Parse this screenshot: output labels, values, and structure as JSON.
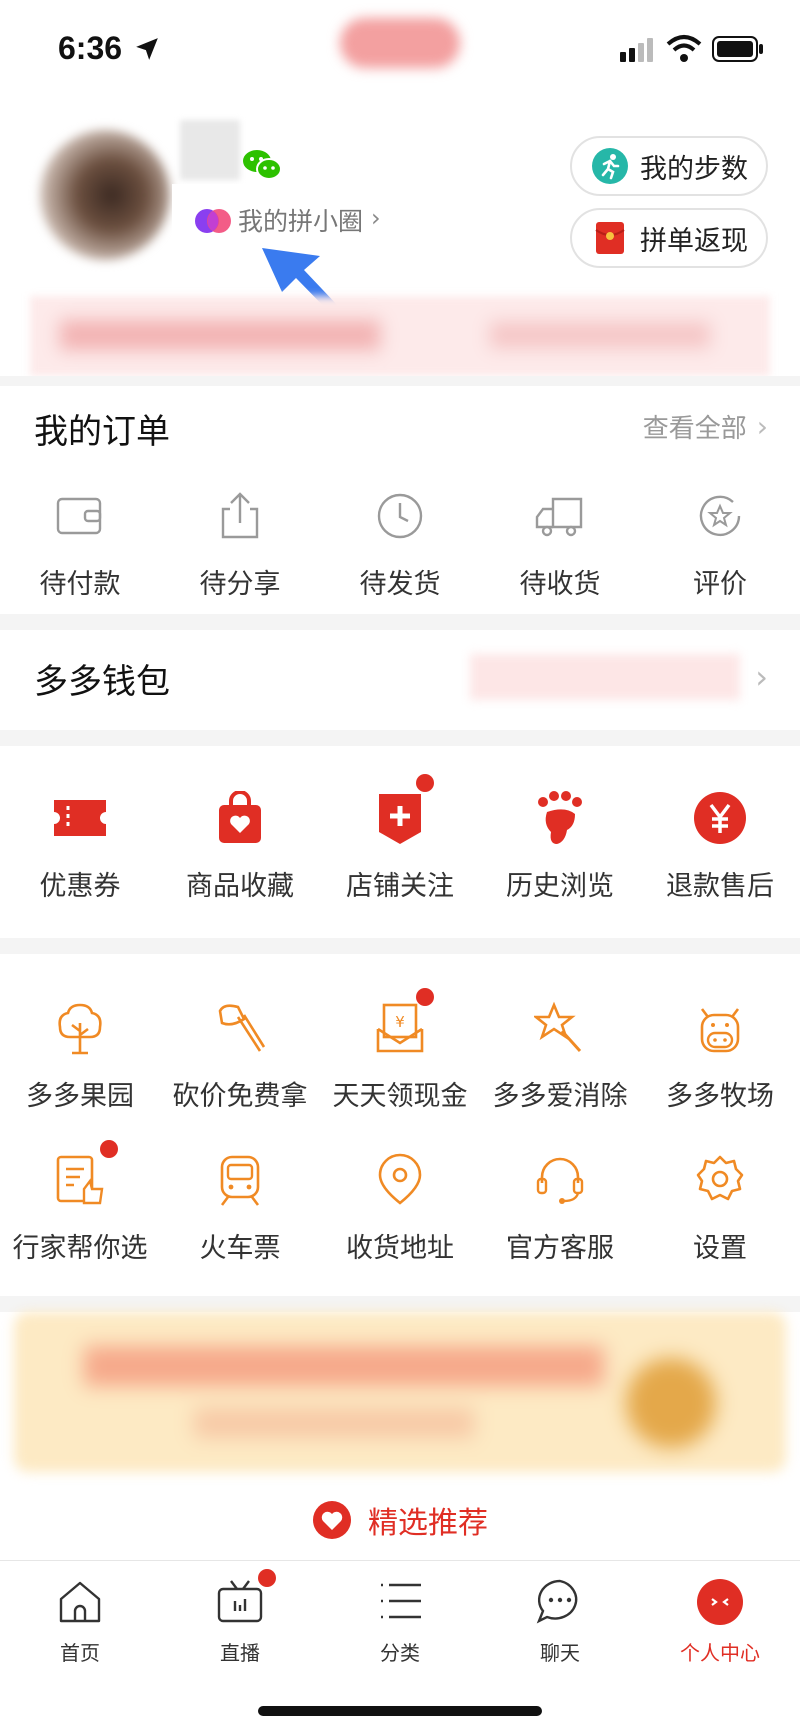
{
  "status_bar": {
    "time": "6:36"
  },
  "profile": {
    "circle_link_label": "我的拼小圈",
    "buttons": [
      {
        "label": "我的步数",
        "icon": "running-icon"
      },
      {
        "label": "拼单返现",
        "icon": "red-envelope-icon"
      }
    ]
  },
  "orders": {
    "title": "我的订单",
    "see_all": "查看全部",
    "items": [
      {
        "label": "待付款",
        "icon": "wallet-icon"
      },
      {
        "label": "待分享",
        "icon": "share-icon"
      },
      {
        "label": "待发货",
        "icon": "clock-icon"
      },
      {
        "label": "待收货",
        "icon": "truck-icon"
      },
      {
        "label": "评价",
        "icon": "star-review-icon"
      }
    ]
  },
  "wallet": {
    "title": "多多钱包"
  },
  "quick_links": [
    {
      "label": "优惠券",
      "icon": "coupon-icon",
      "badge": false
    },
    {
      "label": "商品收藏",
      "icon": "bag-heart-icon",
      "badge": false
    },
    {
      "label": "店铺关注",
      "icon": "shop-plus-icon",
      "badge": true
    },
    {
      "label": "历史浏览",
      "icon": "footprint-icon",
      "badge": false
    },
    {
      "label": "退款售后",
      "icon": "yen-icon",
      "badge": false
    }
  ],
  "services_row1": [
    {
      "label": "多多果园",
      "icon": "tree-icon",
      "badge": false
    },
    {
      "label": "砍价免费拿",
      "icon": "axe-icon",
      "badge": false
    },
    {
      "label": "天天领现金",
      "icon": "cash-envelope-icon",
      "badge": true
    },
    {
      "label": "多多爱消除",
      "icon": "star-wand-icon",
      "badge": false
    },
    {
      "label": "多多牧场",
      "icon": "cow-icon",
      "badge": false
    }
  ],
  "services_row2": [
    {
      "label": "行家帮你选",
      "icon": "document-thumb-icon",
      "badge": true
    },
    {
      "label": "火车票",
      "icon": "train-icon",
      "badge": false
    },
    {
      "label": "收货地址",
      "icon": "location-icon",
      "badge": false
    },
    {
      "label": "官方客服",
      "icon": "headset-icon",
      "badge": false
    },
    {
      "label": "设置",
      "icon": "gear-icon",
      "badge": false
    }
  ],
  "recommend": {
    "label": "精选推荐"
  },
  "tabbar": [
    {
      "label": "首页",
      "icon": "home-icon",
      "active": false,
      "badge": false
    },
    {
      "label": "直播",
      "icon": "tv-icon",
      "active": false,
      "badge": true
    },
    {
      "label": "分类",
      "icon": "list-icon",
      "active": false,
      "badge": false
    },
    {
      "label": "聊天",
      "icon": "chat-icon",
      "active": false,
      "badge": false
    },
    {
      "label": "个人中心",
      "icon": "profile-face-icon",
      "active": true,
      "badge": false
    }
  ],
  "colors": {
    "accent": "#e02e24",
    "orange": "#f08a24",
    "gray_icon": "#9a9a9a"
  }
}
